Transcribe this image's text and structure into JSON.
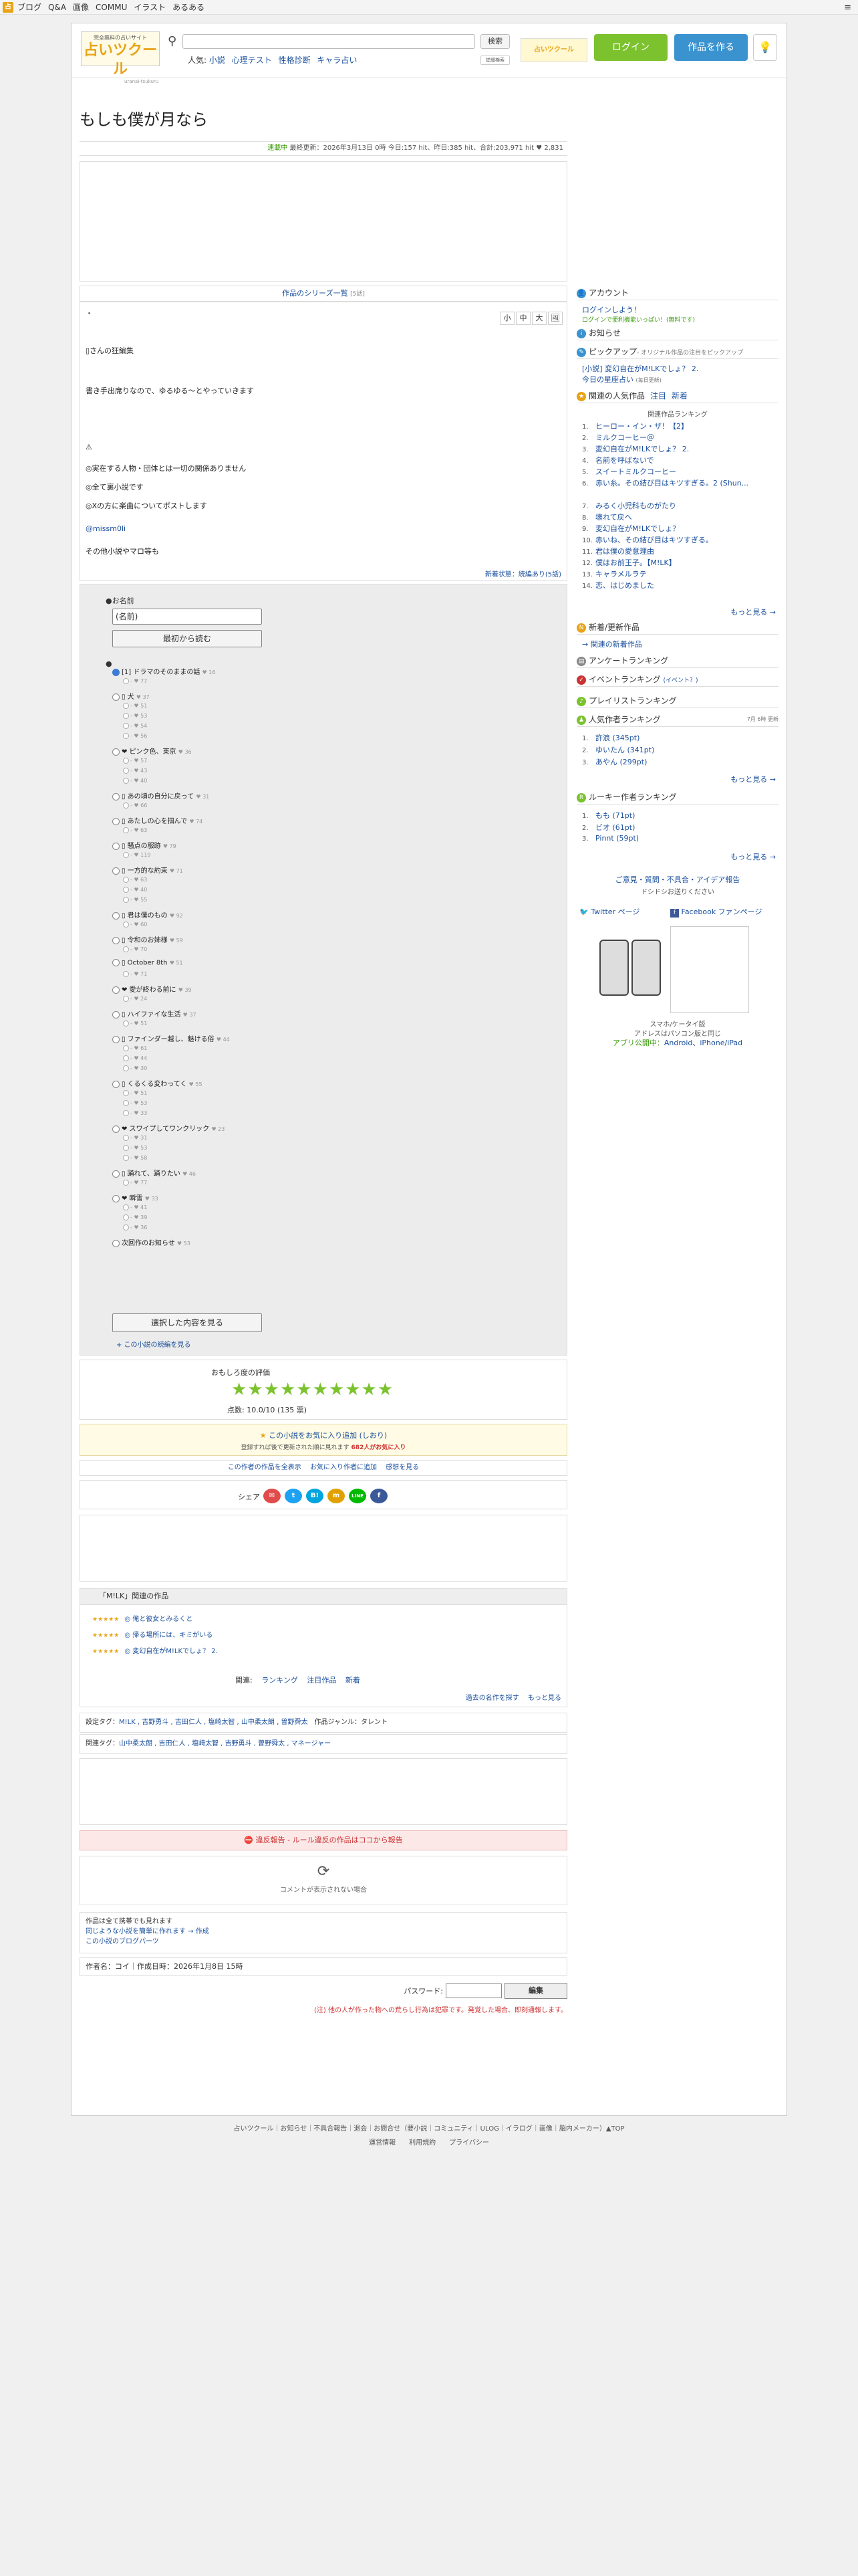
{
  "topbar": {
    "items": [
      "ブログ",
      "Q&A",
      "画像",
      "COMMU",
      "イラスト",
      "あるある"
    ],
    "menu": "≡"
  },
  "header": {
    "logo_tagline": "完全無料の占いサイト",
    "logo_name": "占いツクール",
    "logo_sub": "uranai-tsukuru",
    "search_button": "検索",
    "popular_label": "人気:",
    "popular_links": [
      "小説",
      "心理テスト",
      "性格診断",
      "キャラ占い"
    ],
    "search_options": "詳細検索",
    "banner": "占いツクール",
    "login": "ログイン",
    "create": "作品を作る",
    "hint": "💡"
  },
  "novel": {
    "title": "もしも僕が月なら",
    "meta_status": "連載中",
    "meta_updated": "最終更新：2026年3月13日 0時",
    "meta_hits": "今日:157 hit、昨日:385 hit、合計:203,971 hit",
    "meta_ratings": "2,831",
    "series_label": "作品のシリーズ一覧",
    "series_count": "[5話]",
    "dot": "・",
    "font_small": "小",
    "font_mid": "中",
    "font_large": "大",
    "body_lines": [
      "▯さんの狂編集",
      "書き手出席りなので、ゆるゆる～とやっていきます",
      "⚠",
      "◎実在する人物・団体とは一切の関係ありません",
      "◎全て裏小説です",
      "◎Xの方に楽曲についてポストします",
      "@missm0li",
      "その他小説やマロ等も"
    ],
    "new_info": "新着状態：続編あり(5話)"
  },
  "choices": {
    "name_label": "●お名前",
    "name_value": "(名前)",
    "read_first": "最初から読む",
    "bullet": "●",
    "options": [
      {
        "label": "[1] ドラマのそのままの話",
        "count": "♥ 16",
        "selected": true,
        "subs": [
          "- ♥ 77"
        ]
      },
      {
        "label": "▯ 犬",
        "count": "♥ 37",
        "selected": false,
        "subs": [
          "- ♥ 51",
          "- ♥ 53",
          "- ♥ 54",
          "- ♥ 56"
        ]
      },
      {
        "label": "❤ ピンク色、東京",
        "count": "♥ 36",
        "selected": false,
        "subs": [
          "- ♥ 57",
          "- ♥ 43",
          "- ♥ 40"
        ]
      },
      {
        "label": "▯ あの頃の自分に戻って",
        "count": "♥ 31",
        "selected": false,
        "subs": [
          "- ♥ 66"
        ]
      },
      {
        "label": "▯ あたしの心を掴んで",
        "count": "♥ 74",
        "selected": false,
        "subs": [
          "- ♥ 63"
        ]
      },
      {
        "label": "▯ 騒点の服跡",
        "count": "♥ 79",
        "selected": false,
        "subs": [
          "- ♥ 119"
        ]
      },
      {
        "label": "▯ 一方的な約束",
        "count": "♥ 71",
        "selected": false,
        "subs": [
          "- ♥ 63",
          "- ♥ 40",
          "- ♥ 55"
        ]
      },
      {
        "label": "▯ 君は僕のもの",
        "count": "♥ 92",
        "selected": false,
        "subs": [
          "- ♥ 60"
        ]
      },
      {
        "label": "▯ 令和のお姉様",
        "count": "♥ 59",
        "selected": false,
        "subs": [
          "- ♥ 70"
        ]
      },
      {
        "label": "▯ October 8th",
        "count": "♥ 51",
        "selected": false,
        "subs": [
          "- ♥ 71"
        ]
      },
      {
        "label": "❤ 愛が終わる前に",
        "count": "♥ 39",
        "selected": false,
        "subs": [
          "- ♥ 24"
        ]
      },
      {
        "label": "▯ ハイファイな生活",
        "count": "♥ 37",
        "selected": false,
        "subs": [
          "- ♥ 51"
        ]
      },
      {
        "label": "▯ ファインダー越し、魅ける俗",
        "count": "♥ 44",
        "selected": false,
        "subs": [
          "- ♥ 61",
          "- ♥ 44",
          "- ♥ 30"
        ]
      },
      {
        "label": "▯ くるくる変わってく",
        "count": "♥ 55",
        "selected": false,
        "subs": [
          "- ♥ 51",
          "- ♥ 53",
          "- ♥ 33"
        ]
      },
      {
        "label": "❤ スワイプしてワンクリック",
        "count": "♥ 23",
        "selected": false,
        "subs": [
          "- ♥ 31",
          "- ♥ 53",
          "- ♥ 58"
        ]
      },
      {
        "label": "▯ 踊れて、踊りたい",
        "count": "♥ 46",
        "selected": false,
        "subs": [
          "- ♥ 77"
        ]
      },
      {
        "label": "❤ 瞬雪",
        "count": "♥ 33",
        "selected": false,
        "subs": [
          "- ♥ 41",
          "- ♥ 39",
          "- ♥ 36"
        ]
      },
      {
        "label": "次回作のお知らせ",
        "count": "♥ 53",
        "selected": false,
        "subs": []
      }
    ],
    "view_selected": "選択した内容を見る",
    "tree_link": "+ この小説の続編を見る"
  },
  "rating": {
    "title": "おもしろ度の評価",
    "stars": 10,
    "score_label": "点数:",
    "score": "10.0/10 (135 票)"
  },
  "favorite": {
    "line1": "この小説をお気に入り追加 (しおり)",
    "line2": "登録すれば後で更新された順に見れます",
    "count": "682人がお気に入り"
  },
  "links_row": [
    "この作者の作品を全表示",
    "お気に入り作者に追加",
    "感想を見る"
  ],
  "share": {
    "label": "シェア",
    "icons": [
      "mail-icon",
      "twitter-icon",
      "hatena-icon",
      "mixi-icon",
      "line-icon",
      "facebook-icon"
    ],
    "icon_text": [
      "✉",
      "t",
      "B!",
      "m",
      "LINE",
      "f"
    ],
    "icon_colors": [
      "#e04b4b",
      "#1da1f2",
      "#00a4de",
      "#e0a000",
      "#00b900",
      "#3b5998"
    ]
  },
  "related": {
    "header": "「M!LK」関連の作品",
    "items": [
      "◎ 俺と彼女とみるくと",
      "◎ 帰る場所には、キミがいる",
      "◎ 変幻自在がM!LKでしょ？ 2."
    ],
    "keywords_label": "関連:",
    "keywords": [
      "ランキング",
      "注目作品",
      "新着"
    ],
    "more_past": "過去の名作を探す",
    "more": "もっと見る"
  },
  "tags": {
    "setting_label": "設定タグ：",
    "setting": "M!LK , 吉野勇斗 , 吉田仁人 , 塩崎太智 , 山中柔太朗 , 曽野舜太",
    "genre": "作品ジャンル：タレント",
    "related_label": "関連タグ：",
    "related": "山中柔太朗 , 吉田仁人 , 塩崎太智 , 吉野勇斗 , 曽野舜太 , マネージャー"
  },
  "report": "違反報告 - ルール違反の作品はココから報告",
  "comment": {
    "spinner": "⟳",
    "text": "コメントが表示されない場合"
  },
  "notes": [
    "作品は全て携帯でも見れます",
    "同じような小説を簡単に作れます → 作成",
    "この小説のブログパーツ"
  ],
  "author": "作者名：コイ｜作成日時：2026年1月8日 15時",
  "password": {
    "label": "パスワード:",
    "button": "編集"
  },
  "warning": "(注) 他の人が作った物への荒らし行為は犯罪です。発覚した場合、即刻通報します。",
  "sidebar": {
    "account_header": "アカウント",
    "login_link": "ログインしよう！",
    "login_sub": "ログインで便利機能いっぱい！(無料です)",
    "notice_header": "お知らせ",
    "pickup_header": "ピックアップ",
    "pickup_sub": "- オリジナル作品の注目をピックアップ",
    "pickup_items": [
      "[小説] 変幻自在がM!LKでしょ？ 2.",
      "今日の星座占い"
    ],
    "pickup_note": "(毎日更新)",
    "popular_header": "関連の人気作品",
    "popular_tabs": [
      "注目",
      "新着"
    ],
    "popular_caption": "関連作品ランキング",
    "ranks": [
      "ヒーロー・イン・ザ！【2】",
      "ミルクコーヒー＠",
      "変幻自在がM!LKでしょ？ 2.",
      "名前を呼ばないで",
      "スイートミルクコーヒー",
      "赤い糸。その結び目はキツすぎる。2 (Shun...",
      "みるく小児科ものがたり",
      "壊れて戻へ",
      "変幻自在がM!LKでしょ？",
      "赤いね、その結び目はキツすぎる。",
      "君は僕の愛意理由",
      "僕はお前王子。【M!LK】",
      "キャラメルラテ",
      "恋、はじめました"
    ],
    "more": "もっと見る →",
    "new_header": "新着/更新作品",
    "new_link": "→ 関連の新着作品",
    "survey_header": "アンケートランキング",
    "event_header": "イベントランキング",
    "event_sub": "(イベント？)",
    "play_header": "プレイリストランキング",
    "author_header": "人気作者ランキング",
    "author_date": "7月 6時 更新",
    "authors": [
      "許浪 (345pt)",
      "ゆいたん (341pt)",
      "あやん (299pt)"
    ],
    "rookie_header": "ルーキー作者ランキング",
    "rookies": [
      "もも (71pt)",
      "ビオ (61pt)",
      "Pinnt (59pt)"
    ],
    "feedback_title": "ご意見・質問・不具合・アイデア報告",
    "feedback_sub": "ドシドシお送りください",
    "twitter": "Twitter ページ",
    "facebook": "Facebook ファンページ",
    "mobile_caption": "スマホ/ケータイ版",
    "mobile_sub": "アドレスはパソコン版と同じ",
    "app_label": "アプリ公開中：",
    "app_platforms": "Android、iPhone/iPad"
  },
  "footer": {
    "line1": "占いツクール｜お知らせ｜不具合報告｜退会｜お問合せ（要小説｜コミュニティ｜ULOG｜イラログ｜画像｜脳内メーカー）▲TOP",
    "line2": "運営情報　　利用規約　　プライバシー"
  }
}
